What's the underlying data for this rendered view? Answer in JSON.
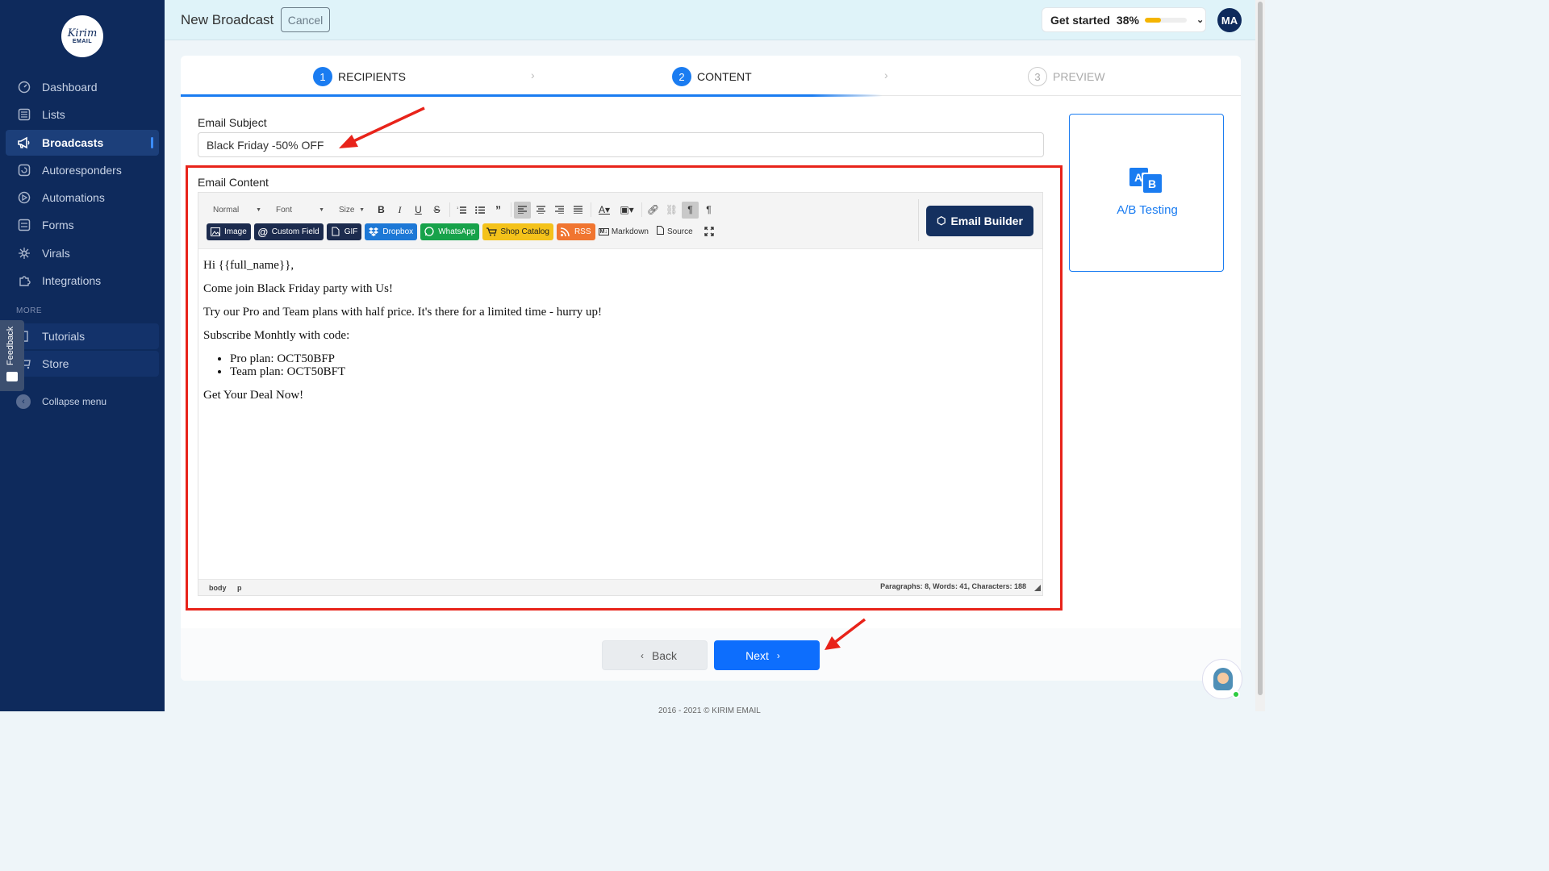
{
  "brand": {
    "logo_line1": "Kirim",
    "logo_line2": "EMAIL"
  },
  "sidebar": {
    "items": [
      {
        "label": "Dashboard",
        "icon": "dashboard-icon"
      },
      {
        "label": "Lists",
        "icon": "list-icon"
      },
      {
        "label": "Broadcasts",
        "icon": "megaphone-icon",
        "active": true
      },
      {
        "label": "Autoresponders",
        "icon": "autoresponder-icon"
      },
      {
        "label": "Automations",
        "icon": "automation-icon"
      },
      {
        "label": "Forms",
        "icon": "form-icon"
      },
      {
        "label": "Virals",
        "icon": "viral-icon"
      },
      {
        "label": "Integrations",
        "icon": "puzzle-icon"
      }
    ],
    "more_heading": "MORE",
    "more_items": [
      {
        "label": "Tutorials",
        "icon": "book-icon"
      },
      {
        "label": "Store",
        "icon": "cart-icon"
      }
    ],
    "collapse_label": "Collapse menu",
    "feedback_label": "Feedback"
  },
  "header": {
    "title": "New Broadcast",
    "cancel_label": "Cancel",
    "get_started_label": "Get started",
    "get_started_pct": "38%",
    "get_started_progress": 0.38,
    "avatar_initials": "MA"
  },
  "steps": [
    {
      "num": "1",
      "label": "RECIPIENTS",
      "state": "done"
    },
    {
      "num": "2",
      "label": "CONTENT",
      "state": "current"
    },
    {
      "num": "3",
      "label": "PREVIEW",
      "state": "todo"
    }
  ],
  "form": {
    "subject_label": "Email Subject",
    "subject_value": "Black Friday -50% OFF",
    "content_label": "Email Content"
  },
  "editor": {
    "format_combo": "Normal",
    "font_combo": "Font",
    "size_combo": "Size",
    "insert_buttons": [
      {
        "label": "Image",
        "style": "dk"
      },
      {
        "label": "Custom Field",
        "style": "dk"
      },
      {
        "label": "GIF",
        "style": "dk"
      },
      {
        "label": "Dropbox",
        "style": "blue"
      },
      {
        "label": "WhatsApp",
        "style": "green"
      },
      {
        "label": "Shop Catalog",
        "style": "yellow"
      },
      {
        "label": "RSS",
        "style": "orange"
      }
    ],
    "markdown_label": "Markdown",
    "source_label": "Source",
    "email_builder_label": "Email Builder",
    "body": {
      "greeting": "Hi {{full_name}},",
      "line1": "Come join Black Friday party with Us!",
      "line2": "Try our Pro and Team plans with half price. It's there for a limited time - hurry up!",
      "line3": "Subscribe Monhtly with code:",
      "bullets": [
        "Pro plan: OCT50BFP",
        "Team plan: OCT50BFT"
      ],
      "closing": "Get Your Deal Now!"
    },
    "status": {
      "crumb_body": "body",
      "crumb_p": "p",
      "counts": "Paragraphs: 8, Words: 41, Characters: 188"
    }
  },
  "ab_testing": {
    "label": "A/B Testing",
    "icon_a": "A",
    "icon_b": "B"
  },
  "nav_buttons": {
    "back": "Back",
    "next": "Next"
  },
  "footer": {
    "copyright": "2016 - 2021 © KIRIM EMAIL"
  },
  "colors": {
    "sidebar": "#0e2a5c",
    "primary": "#1a7cf1",
    "annotation_red": "#e8231a",
    "progress": "#f4b400"
  }
}
